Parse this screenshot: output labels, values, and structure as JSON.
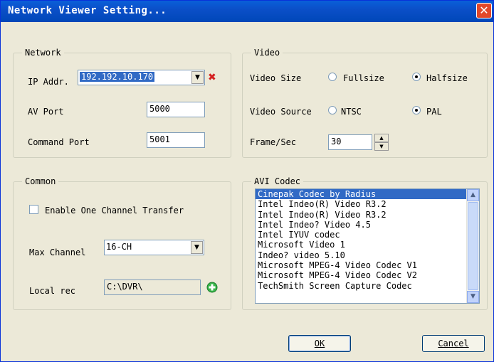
{
  "window": {
    "title": "Network Viewer Setting...",
    "close_glyph": "✕"
  },
  "network": {
    "legend": "Network",
    "ip_label": "IP Addr.",
    "ip_value": "192.192.10.170",
    "av_port_label": "AV Port",
    "av_port_value": "5000",
    "command_port_label": "Command Port",
    "command_port_value": "5001",
    "delete_icon_glyph": "✖"
  },
  "video": {
    "legend": "Video",
    "size_label": "Video Size",
    "size_options": [
      "Fullsize",
      "Halfsize"
    ],
    "size_selected": "Halfsize",
    "source_label": "Video Source",
    "source_options": [
      "NTSC",
      "PAL"
    ],
    "source_selected": "PAL",
    "fps_label": "Frame/Sec",
    "fps_value": "30"
  },
  "common": {
    "legend": "Common",
    "enable_transfer_label": "Enable One Channel Transfer",
    "enable_transfer_checked": false,
    "max_channel_label": "Max Channel",
    "max_channel_value": "16-CH",
    "local_rec_label": "Local rec",
    "local_rec_value": "C:\\DVR\\"
  },
  "avi_codec": {
    "legend": "AVI Codec",
    "items": [
      "Cinepak Codec by Radius",
      "Intel Indeo(R) Video R3.2",
      "Intel Indeo(R) Video R3.2",
      "Intel Indeo? Video 4.5",
      "Intel IYUV codec",
      "Microsoft Video 1",
      "Indeo? video 5.10",
      "Microsoft MPEG-4 Video Codec V1",
      "Microsoft MPEG-4 Video Codec V2",
      "TechSmith Screen Capture Codec"
    ],
    "selected_index": 0
  },
  "buttons": {
    "ok_label": "OK",
    "cancel_label": "Cancel"
  },
  "colors": {
    "titlebar": "#0054e3",
    "selection": "#316ac5",
    "dialog_bg": "#ece9d8"
  }
}
